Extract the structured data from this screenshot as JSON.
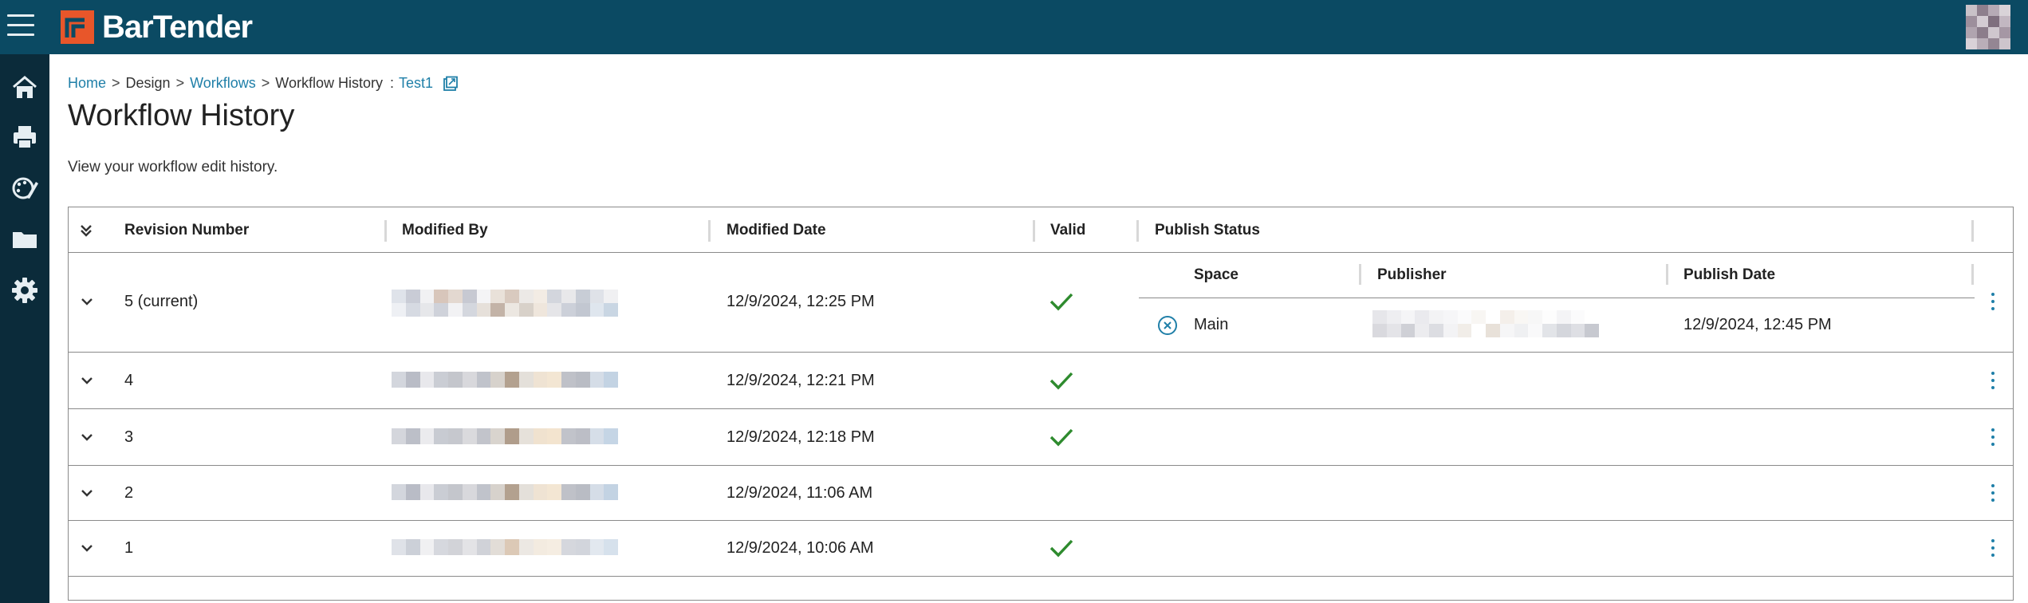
{
  "app": {
    "brand": "BarTender"
  },
  "colors": {
    "topbar": "#0b4a63",
    "sidebar": "#0b2b3a",
    "link": "#1f7fa8",
    "valid": "#2e8b2e",
    "logo_orange": "#e8562a"
  },
  "sidebar": {
    "items": [
      {
        "name": "home-icon"
      },
      {
        "name": "print-icon"
      },
      {
        "name": "design-icon"
      },
      {
        "name": "folder-icon"
      },
      {
        "name": "gear-icon"
      }
    ]
  },
  "breadcrumb": {
    "home": "Home",
    "sep1": ">",
    "design": "Design",
    "sep2": ">",
    "workflows": "Workflows",
    "sep3": ">",
    "current": "Workflow History",
    "colon": ":",
    "item": "Test1"
  },
  "page": {
    "title": "Workflow History",
    "subtitle": "View your workflow edit history."
  },
  "table": {
    "headers": {
      "revision": "Revision Number",
      "modified_by": "Modified By",
      "modified_date": "Modified Date",
      "valid": "Valid",
      "publish_status": "Publish Status"
    },
    "publish_headers": {
      "space": "Space",
      "publisher": "Publisher",
      "publish_date": "Publish Date"
    },
    "rows": [
      {
        "revision": "5 (current)",
        "modified_date": "12/9/2024, 12:25 PM",
        "valid": true,
        "publish": {
          "space": "Main",
          "publish_date": "12/9/2024, 12:45 PM"
        }
      },
      {
        "revision": "4",
        "modified_date": "12/9/2024, 12:21 PM",
        "valid": true
      },
      {
        "revision": "3",
        "modified_date": "12/9/2024, 12:18 PM",
        "valid": true
      },
      {
        "revision": "2",
        "modified_date": "12/9/2024, 11:06 AM",
        "valid": false
      },
      {
        "revision": "1",
        "modified_date": "12/9/2024, 10:06 AM",
        "valid": true
      }
    ]
  }
}
